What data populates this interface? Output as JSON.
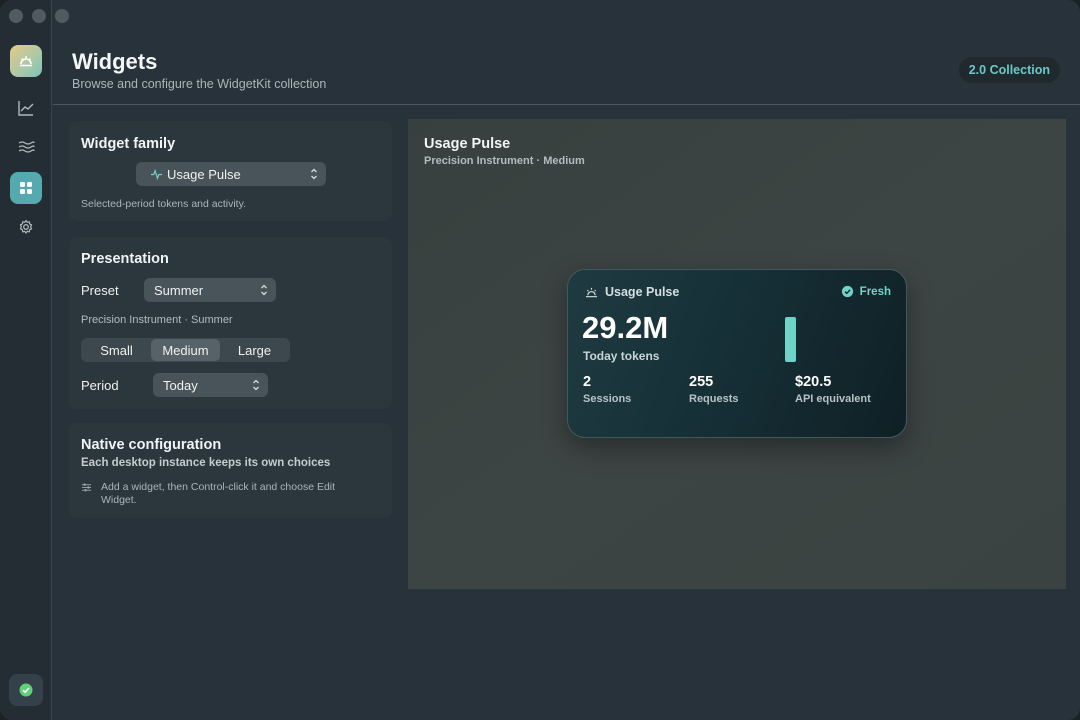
{
  "header": {
    "title": "Widgets",
    "subtitle": "Browse and configure the WidgetKit collection",
    "collection_badge": "2.0 Collection"
  },
  "sidebar": {
    "items": [
      {
        "icon": "app-logo-icon",
        "active": false
      },
      {
        "icon": "chart-line-icon",
        "active": false
      },
      {
        "icon": "waves-icon",
        "active": false
      },
      {
        "icon": "widgets-grid-icon",
        "active": true
      },
      {
        "icon": "gear-icon",
        "active": false
      }
    ],
    "status_icon": "check-circle-icon"
  },
  "widget_family": {
    "title": "Widget family",
    "selected": "Usage Pulse",
    "description": "Selected-period tokens and activity."
  },
  "presentation": {
    "title": "Presentation",
    "preset_label": "Preset",
    "preset_value": "Summer",
    "style_caption": "Precision Instrument · Summer",
    "sizes": [
      "Small",
      "Medium",
      "Large"
    ],
    "selected_size": "Medium",
    "period_label": "Period",
    "period_value": "Today"
  },
  "native_config": {
    "title": "Native configuration",
    "subtitle": "Each desktop instance keeps its own choices",
    "hint": "Add a widget, then Control-click it and choose Edit Widget."
  },
  "preview": {
    "title": "Usage Pulse",
    "subtitle": "Precision Instrument · Medium",
    "widget": {
      "name": "Usage Pulse",
      "status": "Fresh",
      "big_value": "29.2M",
      "big_label": "Today tokens",
      "stats": [
        {
          "value": "2",
          "label": "Sessions"
        },
        {
          "value": "255",
          "label": "Requests"
        },
        {
          "value": "$20.5",
          "label": "API equivalent"
        }
      ]
    }
  },
  "colors": {
    "accent": "#6fd3c8",
    "window_bg": "#27323a",
    "sidebar_bg": "#232d33",
    "panel_bg": "#2b363d"
  }
}
